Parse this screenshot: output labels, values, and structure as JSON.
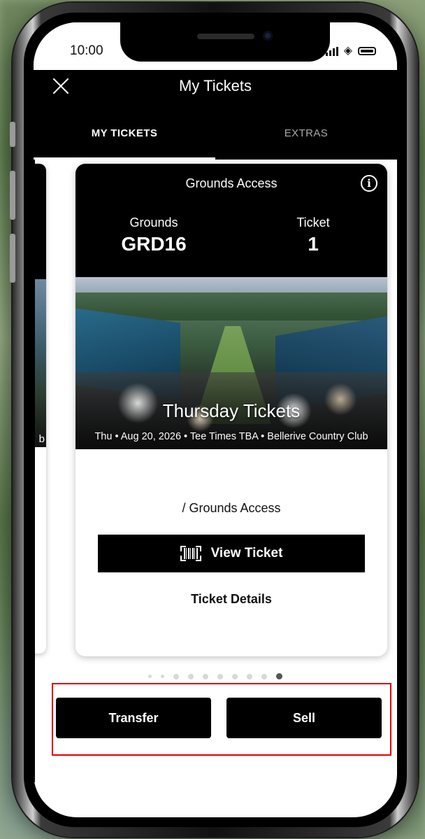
{
  "status_bar": {
    "time": "10:00"
  },
  "header": {
    "title": "My Tickets",
    "tabs": [
      {
        "label": "MY TICKETS",
        "active": true
      },
      {
        "label": "EXTRAS",
        "active": false
      }
    ]
  },
  "previous_card": {
    "partial_text": "b"
  },
  "ticket": {
    "type": "Grounds Access",
    "fields": [
      {
        "label": "Grounds",
        "value": "GRD16"
      },
      {
        "label": "Ticket",
        "value": "1"
      }
    ],
    "event_title": "Thursday Tickets",
    "event_subtitle": "Thu • Aug 20, 2026 • Tee Times TBA • Bellerive Country Club",
    "access_line": "/ Grounds Access",
    "view_button": "View Ticket",
    "details_link": "Ticket Details"
  },
  "pagination": {
    "count": 10,
    "active_index": 9
  },
  "actions": {
    "transfer": "Transfer",
    "sell": "Sell"
  },
  "colors": {
    "accent": "#000000",
    "highlight_border": "#e00000"
  }
}
